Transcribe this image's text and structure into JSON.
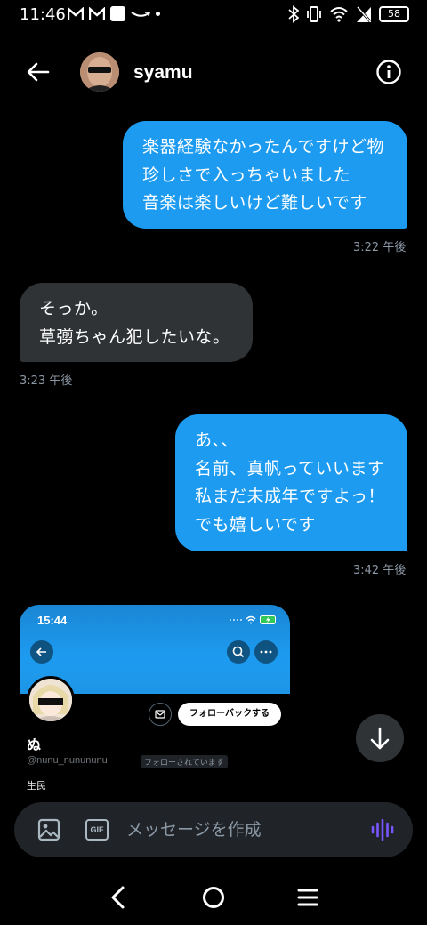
{
  "status_bar": {
    "time": "11:46",
    "battery": "58",
    "icons": [
      "gmail-icon",
      "gmail-icon",
      "square-app-icon",
      "amazon-icon",
      "dot-icon",
      "bluetooth-icon",
      "vibrate-icon",
      "wifi-icon",
      "no-signal-icon",
      "battery-icon"
    ]
  },
  "header": {
    "contact_name": "syamu",
    "back_icon": "arrow-left-icon",
    "info_icon": "info-icon"
  },
  "messages": [
    {
      "direction": "sent",
      "lines": [
        "楽器経験なかったんですけど物",
        "珍しさで入っちゃいました",
        "音楽は楽しいけど難しいです"
      ],
      "time": "3:22 午後"
    },
    {
      "direction": "received",
      "lines": [
        "そっか。",
        "草彅ちゃん犯したいな。"
      ],
      "time": "3:23 午後"
    },
    {
      "direction": "sent",
      "lines": [
        "あ、、",
        "名前、真帆っていいます",
        "私まだ未成年ですよっ！",
        "でも嬉しいです"
      ],
      "time": "3:42 午後"
    }
  ],
  "shared_screenshot": {
    "time": "15:44",
    "follow_button": "フォローバックする",
    "profile_name": "ぬ",
    "handle": "@nunu_nunununu",
    "follows_you": "フォローされています",
    "bio": "生民"
  },
  "composer": {
    "placeholder": "メッセージを作成",
    "gif_label": "GIF"
  },
  "colors": {
    "sent_bubble": "#1d9bf0",
    "received_bubble": "#2f3336",
    "background": "#000000",
    "voice_accent": "#7856ff"
  }
}
